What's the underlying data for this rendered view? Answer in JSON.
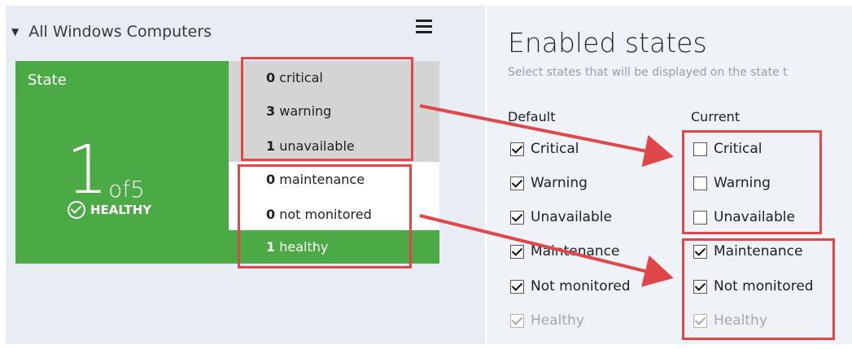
{
  "group": {
    "name": "All Windows Computers"
  },
  "tile": {
    "label": "State",
    "count": "1",
    "of_total": "of5",
    "status": "HEALTHY"
  },
  "counts": [
    {
      "value": "0",
      "label": "critical"
    },
    {
      "value": "3",
      "label": "warning"
    },
    {
      "value": "1",
      "label": "unavailable"
    },
    {
      "value": "0",
      "label": "maintenance"
    },
    {
      "value": "0",
      "label": "not monitored"
    },
    {
      "value": "1",
      "label": "healthy"
    }
  ],
  "settings": {
    "title": "Enabled states",
    "subtitle": "Select states that will be displayed on the state t",
    "default_header": "Default",
    "current_header": "Current",
    "default": [
      {
        "label": "Critical",
        "checked": true,
        "disabled": false
      },
      {
        "label": "Warning",
        "checked": true,
        "disabled": false
      },
      {
        "label": "Unavailable",
        "checked": true,
        "disabled": false
      },
      {
        "label": "Maintenance",
        "checked": true,
        "disabled": false
      },
      {
        "label": "Not monitored",
        "checked": true,
        "disabled": false
      },
      {
        "label": "Healthy",
        "checked": true,
        "disabled": true
      }
    ],
    "current": [
      {
        "label": "Critical",
        "checked": false,
        "disabled": false
      },
      {
        "label": "Warning",
        "checked": false,
        "disabled": false
      },
      {
        "label": "Unavailable",
        "checked": false,
        "disabled": false
      },
      {
        "label": "Maintenance",
        "checked": true,
        "disabled": false
      },
      {
        "label": "Not monitored",
        "checked": true,
        "disabled": false
      },
      {
        "label": "Healthy",
        "checked": true,
        "disabled": true
      }
    ]
  },
  "colors": {
    "healthy_green": "#4caa46",
    "highlight_red": "#e0474b",
    "panel_bg": "#e8edf4"
  }
}
